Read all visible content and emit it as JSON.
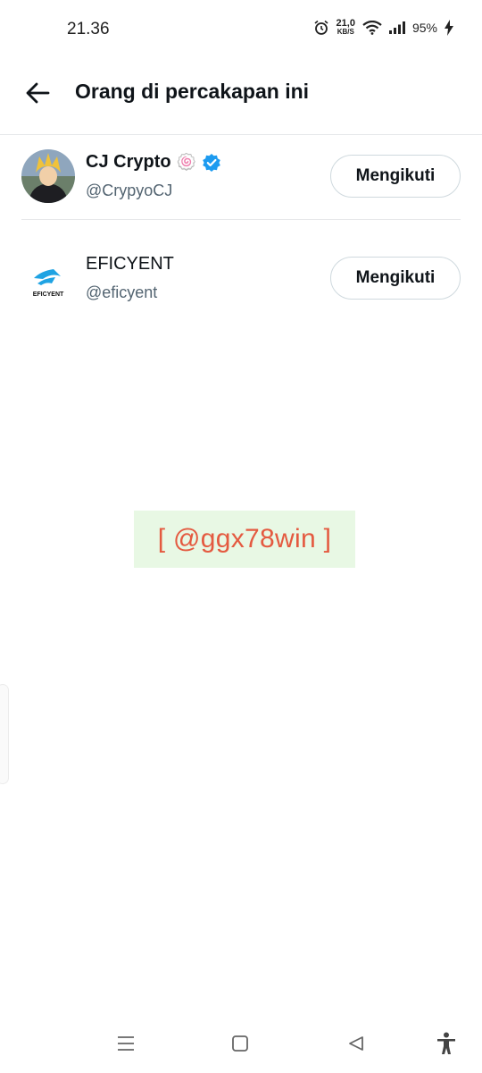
{
  "status_bar": {
    "time": "21.36",
    "net_speed_value": "21,0",
    "net_speed_unit": "KB/S",
    "battery": "95%"
  },
  "header": {
    "title": "Orang di percakapan ini"
  },
  "people": [
    {
      "name": "CJ Crypto",
      "handle": "@CrypyoCJ",
      "verified": true,
      "badge_emoji": "🍥",
      "follow_label": "Mengikuti"
    },
    {
      "name": "EFICYENT",
      "handle": "@eficyent",
      "verified": false,
      "logo_text": "EFICYENT",
      "follow_label": "Mengikuti"
    }
  ],
  "watermark": {
    "text": "[ @ggx78win ]"
  },
  "icons": {
    "back": "arrow-left-icon",
    "verified": "verified-badge-icon",
    "nav_menu": "menu-icon",
    "nav_home": "home-square-icon",
    "nav_back": "triangle-back-icon",
    "nav_access": "accessibility-icon"
  },
  "colors": {
    "verified_blue": "#1d9bf0",
    "watermark_text": "#e45a40",
    "watermark_bg": "#e8f8e4",
    "secondary_text": "#536471"
  }
}
